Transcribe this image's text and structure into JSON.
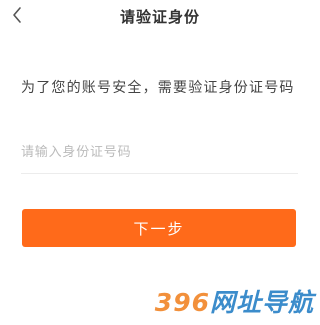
{
  "nav": {
    "back_icon": "chevron-left-icon",
    "title": "请验证身份"
  },
  "prompt": "为了您的账号安全，需要验证身份证号码",
  "id_input": {
    "placeholder": "请输入身份证号码",
    "value": ""
  },
  "next_button_label": "下一步",
  "watermark": {
    "digits": "396",
    "chars": "网址导航"
  },
  "colors": {
    "accent": "#ff6a1a",
    "title_text": "#333333",
    "placeholder": "#bbbbbb",
    "watermark_orange": "#f07d1a",
    "watermark_blue": "#1a78c2"
  }
}
